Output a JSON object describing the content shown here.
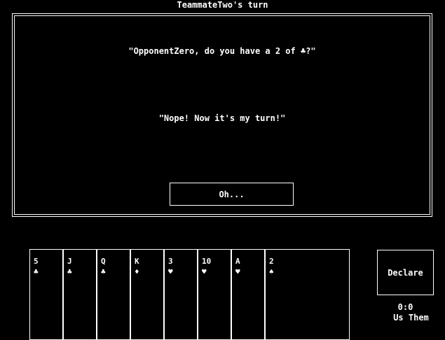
{
  "header": {
    "title": "TeammateTwo's turn"
  },
  "dialog": {
    "question": "\"OpponentZero, do you have a 2 of ♣?\"",
    "answer": "\"Nope! Now it's my turn!\"",
    "ok_label": "Oh..."
  },
  "hand": {
    "cards": [
      {
        "rank": "5",
        "suit": "♣",
        "suit_name": "clubs-icon"
      },
      {
        "rank": "J",
        "suit": "♣",
        "suit_name": "clubs-icon"
      },
      {
        "rank": "Q",
        "suit": "♣",
        "suit_name": "clubs-icon"
      },
      {
        "rank": "K",
        "suit": "♦",
        "suit_name": "diamonds-icon"
      },
      {
        "rank": "3",
        "suit": "♥",
        "suit_name": "hearts-icon"
      },
      {
        "rank": "10",
        "suit": "♥",
        "suit_name": "hearts-icon"
      },
      {
        "rank": "A",
        "suit": "♥",
        "suit_name": "hearts-icon"
      },
      {
        "rank": "2",
        "suit": "♠",
        "suit_name": "spades-icon"
      }
    ]
  },
  "controls": {
    "declare_label": "Declare"
  },
  "score": {
    "value": "0:0",
    "label": "Us Them"
  },
  "colors": {
    "background": "#000000",
    "foreground": "#ffffff"
  }
}
